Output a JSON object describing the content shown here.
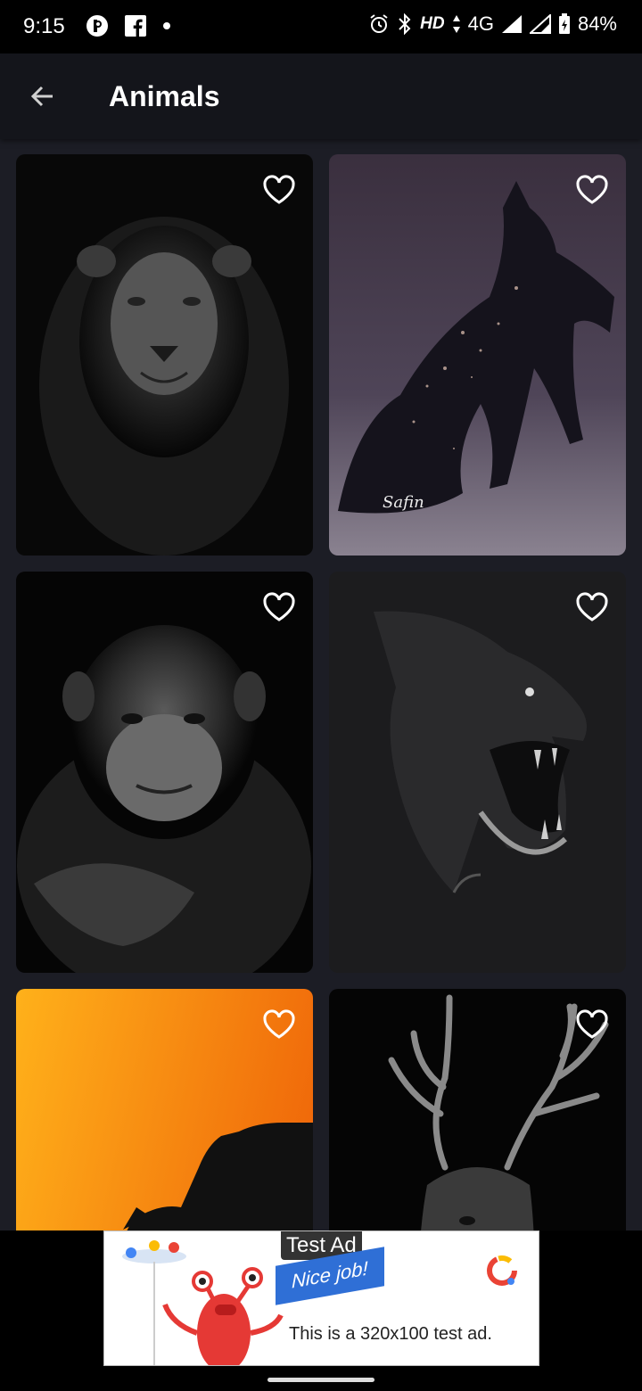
{
  "status_bar": {
    "time": "9:15",
    "network": "HD",
    "cell": "4G",
    "battery": "84%"
  },
  "app_bar": {
    "title": "Animals"
  },
  "cards": [
    {
      "subject": "lion",
      "signature": ""
    },
    {
      "subject": "wolf",
      "signature": "Safin"
    },
    {
      "subject": "chimpanzee",
      "signature": ""
    },
    {
      "subject": "gorilla",
      "signature": ""
    },
    {
      "subject": "rhino-sunset",
      "signature": ""
    },
    {
      "subject": "deer",
      "signature": ""
    }
  ],
  "ad": {
    "badge": "Test Ad",
    "headline": "Nice job!",
    "description": "This is a 320x100 test ad."
  },
  "colors": {
    "app_bar_bg": "#14151b",
    "page_bg": "#1c1d25",
    "status_bar_bg": "#000000",
    "ad_blue": "#2f6fd6"
  }
}
